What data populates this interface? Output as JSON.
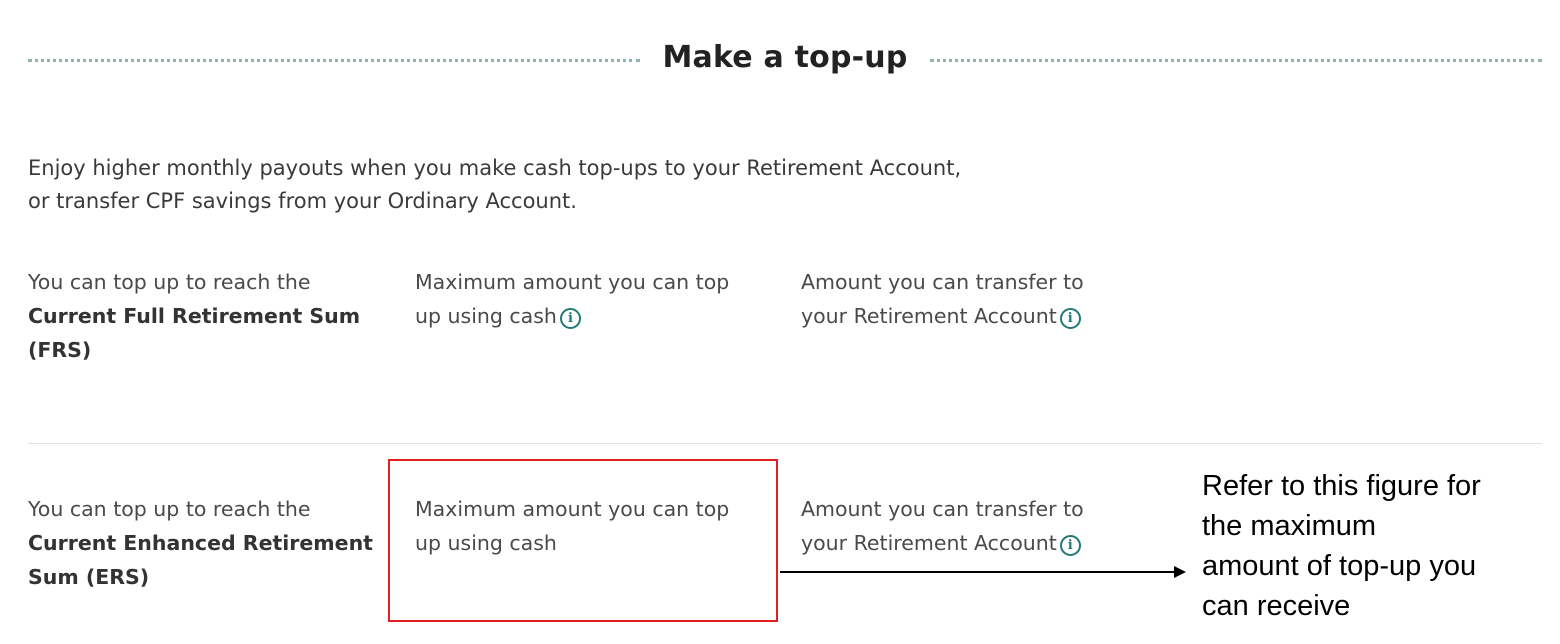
{
  "header": {
    "title": "Make a top-up"
  },
  "intro": {
    "line1": "Enjoy higher monthly payouts when you make cash top-ups to your Retirement Account,",
    "line2": "or transfer CPF savings from your Ordinary Account."
  },
  "frs_row": {
    "col1_line1": "You can top up to reach the",
    "col1_line2": "Current Full Retirement Sum",
    "col1_line3": "(FRS)",
    "col2_line1": "Maximum amount you can top",
    "col2_line2": "up using cash",
    "col3_line1": "Amount you can transfer to",
    "col3_line2": "your Retirement Account"
  },
  "ers_row": {
    "col1_line1": "You can top up to reach the",
    "col1_line2": "Current Enhanced Retirement",
    "col1_line3": "Sum (ERS)",
    "col2_line1": "Maximum amount you can top",
    "col2_line2": "up using cash",
    "col3_line1": "Amount you can transfer to",
    "col3_line2": "your Retirement Account"
  },
  "icons": {
    "info": "info-circle-icon",
    "info_glyph": "i"
  },
  "annotation": {
    "line1": "Refer to this figure for",
    "line2": "the maximum",
    "line3": "amount of top-up you",
    "line4": "can receive"
  },
  "colors": {
    "accent": "#1f7a74",
    "dotted_line": "#8fb5b2",
    "highlight": "#e02020"
  }
}
